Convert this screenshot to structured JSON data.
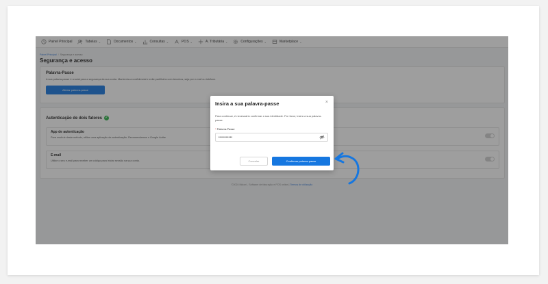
{
  "nav": {
    "items": [
      {
        "label": "Painel Principal",
        "icon": "clock-icon",
        "has_menu": false
      },
      {
        "label": "Tabelas",
        "icon": "users-icon",
        "has_menu": true
      },
      {
        "label": "Documentos",
        "icon": "document-icon",
        "has_menu": true
      },
      {
        "label": "Consultas",
        "icon": "chart-icon",
        "has_menu": true
      },
      {
        "label": "POS",
        "icon": "pos-icon",
        "has_menu": true
      },
      {
        "label": "A. Tributária",
        "icon": "plus-icon",
        "has_menu": true
      },
      {
        "label": "Configurações",
        "icon": "settings-icon",
        "has_menu": true
      },
      {
        "label": "Marketplace",
        "icon": "store-icon",
        "has_menu": true
      }
    ],
    "chevron": "⌄"
  },
  "breadcrumb": {
    "home": "Painel Principal",
    "separator": "/",
    "current": "Segurança e acesso"
  },
  "page_title": "Segurança e acesso",
  "password_section": {
    "title": "Palavra-Passe",
    "description": "A sua palavra-passe é crucial para a segurança da sua conta. Mantenha-a confidencial e evite partilhá-la com terceiros, seja por e-mail ou telefone.",
    "button": "Alterar palavra-passe"
  },
  "twofa_section": {
    "title": "Autenticação de dois fatores",
    "check": "✓",
    "items": [
      {
        "title": "App de autenticação",
        "description": "Para usufruir deste método, utilize uma aplicação de autenticação. Recomendamos o Google Authe",
        "enabled": false
      },
      {
        "title": "E-mail",
        "description": "Utilize o seu e-mail para receber um código para iniciar sessão na sua conta.",
        "enabled": false
      }
    ]
  },
  "footer": {
    "text": "©2024 Moloni - Software de faturação e POS online |",
    "link": "Termos de utilização"
  },
  "modal": {
    "title": "Insira a sua palavra-passe",
    "close": "×",
    "message": "Para continuar, é necessário confirmar a sua identidade. Por favor, insira a sua palavra-passe.",
    "field_required": "*",
    "field_label": "Palavra-Passe",
    "field_value": "••••••••••",
    "cancel_label": "Cancelar",
    "confirm_label": "Confirmar palavra-passe"
  },
  "colors": {
    "primary": "#1677e0",
    "success": "#2eb34a",
    "arrow": "#1677e0"
  }
}
